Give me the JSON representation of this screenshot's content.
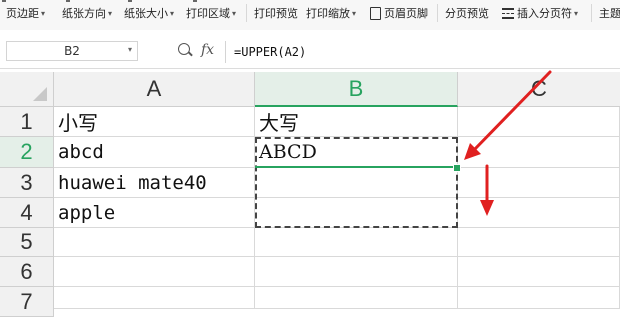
{
  "toolbar": {
    "margins": "页边距",
    "orientation": "纸张方向",
    "paper_size": "纸张大小",
    "print_area": "打印区域",
    "print_preview": "打印预览",
    "print_scale": "打印缩放",
    "header_footer": "页眉页脚",
    "page_break_preview": "分页预览",
    "insert_page_break": "插入分页符",
    "theme": "主题"
  },
  "formula_bar": {
    "name_box": "B2",
    "fx": "fx",
    "formula": "=UPPER(A2)"
  },
  "columns": [
    "A",
    "B",
    "C"
  ],
  "rows": [
    "1",
    "2",
    "3",
    "4",
    "5",
    "6",
    "7"
  ],
  "cells": {
    "A1": "小写",
    "B1": "大写",
    "A2": "abcd",
    "B2": "ABCD",
    "A3": "huawei mate40",
    "A4": "apple"
  },
  "colors": {
    "accent": "#27a35f",
    "arrow": "#e02020"
  }
}
